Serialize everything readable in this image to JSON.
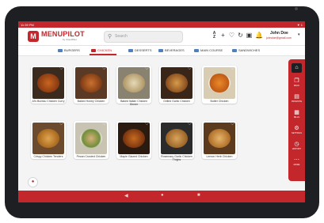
{
  "status": {
    "time": "11:39 PM",
    "right": "▼ 1"
  },
  "header": {
    "logo_text": "MENUPILOT",
    "logo_sub": "by CloudPilot",
    "search_placeholder": "Search",
    "user_name": "John Doe",
    "user_email": "johndoe@gmail.com"
  },
  "tabs": [
    {
      "label": "BURGERS",
      "active": false
    },
    {
      "label": "CHICKEN",
      "active": true
    },
    {
      "label": "DESSERTS",
      "active": false
    },
    {
      "label": "BEVERAGES",
      "active": false
    },
    {
      "label": "MAIN COURSE",
      "active": false
    },
    {
      "label": "SANDWICHES",
      "active": false
    }
  ],
  "items": [
    {
      "name": "Al's Bureau Chicken Curry",
      "img": "curry"
    },
    {
      "name": "Baked Honey Chicken",
      "img": "wings"
    },
    {
      "name": "Baked Italian Chicken Dinner",
      "img": "potatoes"
    },
    {
      "name": "Grilled Garlic Chicken",
      "img": "grilled"
    },
    {
      "name": "Butter Chicken",
      "img": "butter"
    },
    {
      "name": "Crispy Chicken Tenders",
      "img": "tenders"
    },
    {
      "name": "Pecan Crusted Chicken",
      "img": "salad"
    },
    {
      "name": "Maple Glazed Chicken",
      "img": "glazed"
    },
    {
      "name": "Rosemary Garlic Chicken Thighs",
      "img": "thighs"
    },
    {
      "name": "Lemon Herb Chicken",
      "img": "lemon"
    }
  ],
  "sidebar": [
    {
      "label": "HOME",
      "icon": "home-icon"
    },
    {
      "label": "BACK",
      "icon": "back-icon"
    },
    {
      "label": "PROMOTE",
      "icon": "promote-icon"
    },
    {
      "label": "BILLS",
      "icon": "bills-icon"
    },
    {
      "label": "SETTINGS",
      "icon": "settings-icon"
    },
    {
      "label": "HISTORY",
      "icon": "history-icon"
    },
    {
      "label": "MORE",
      "icon": "more-icon"
    }
  ],
  "colors": {
    "accent": "#c3272b",
    "frame": "#1e1f22"
  }
}
